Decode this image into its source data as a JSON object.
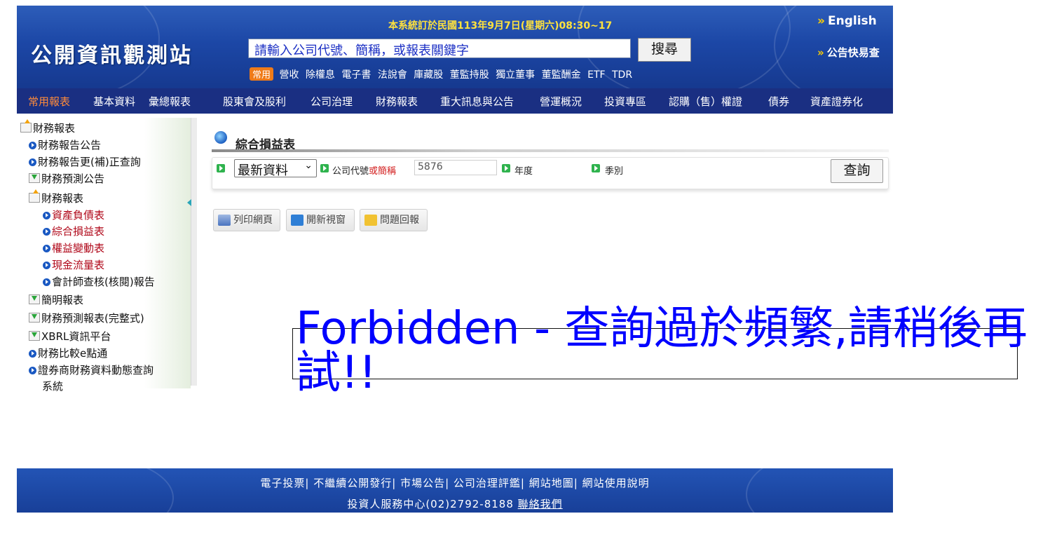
{
  "header": {
    "logo": "公開資訊觀測站",
    "maintenance": "本系統訂於民國113年9月7日(星期六)08:30~17",
    "english": "English",
    "quick_lookup": "公告快易查",
    "search_placeholder": "請輸入公司代號、簡稱，或報表關鍵字",
    "search_button": "搜尋",
    "common_badge": "常用",
    "common_links": [
      "營收",
      "除權息",
      "電子書",
      "法說會",
      "庫藏股",
      "董監持股",
      "獨立董事",
      "董監酬金",
      "ETF",
      "TDR"
    ]
  },
  "nav": [
    "常用報表",
    "基本資料",
    "彙總報表",
    "股東會及股利",
    "公司治理",
    "財務報表",
    "重大訊息與公告",
    "營運概況",
    "投資專區",
    "認購（售）權證",
    "債券",
    "資產證券化"
  ],
  "sidebar": {
    "items": [
      {
        "label": "財務報表"
      },
      {
        "label": "財務報告公告"
      },
      {
        "label": "財務報告更(補)正查詢"
      },
      {
        "label": "財務預測公告"
      },
      {
        "label": "財務報表"
      },
      {
        "label": "資產負債表"
      },
      {
        "label": "綜合損益表"
      },
      {
        "label": "權益變動表"
      },
      {
        "label": "現金流量表"
      },
      {
        "label": "會計師查核(核閱)報告"
      },
      {
        "label": "簡明報表"
      },
      {
        "label": "財務預測報表(完整式)"
      },
      {
        "label": "XBRL資訊平台"
      },
      {
        "label": "財務比較e點通"
      },
      {
        "label": "證券商財務資料動態查詢"
      },
      {
        "label": "系統"
      }
    ]
  },
  "main": {
    "title": "綜合損益表",
    "period_selected": "最新資料",
    "code_label": "公司代號",
    "code_label_alt": "或簡稱",
    "code_value": "5876",
    "year_label": "年度",
    "season_label": "季別",
    "query_button": "查詢",
    "toolbar": {
      "print": "列印網頁",
      "new_window": "開新視窗",
      "feedback": "問題回報"
    }
  },
  "error": {
    "message": "Forbidden - 查詢過於頻繁,請稍後再試!!"
  },
  "footer": {
    "links": [
      "電子投票",
      "不繼續公開發行",
      "市場公告",
      "公司治理評鑑",
      "網站地圖",
      "網站使用說明"
    ],
    "contact": "投資人服務中心(02)2792-8188",
    "contact_link": "聯絡我們"
  },
  "colors": {
    "header_blue": "#1c47a6",
    "nav_blue": "#1a2f82",
    "active_nav": "#ff8b3a",
    "error_blue": "#0000ff",
    "maintenance_yellow": "#ffe23d"
  }
}
